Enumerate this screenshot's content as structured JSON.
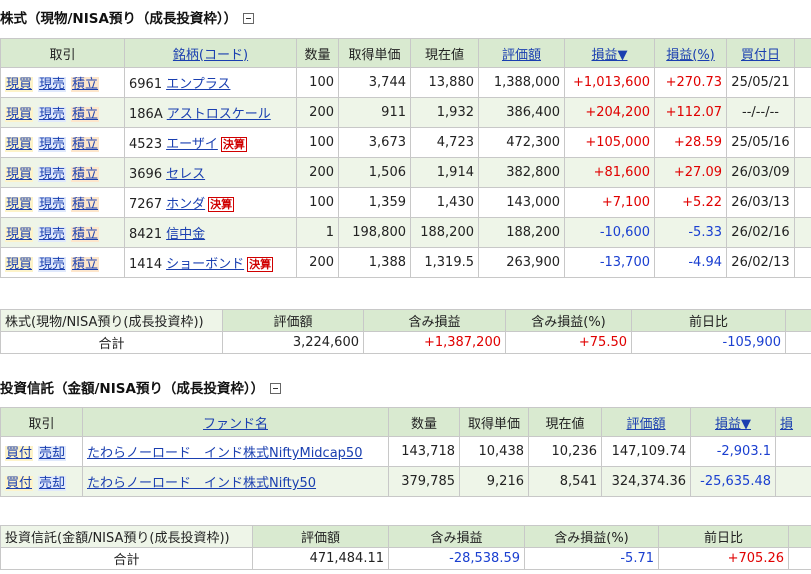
{
  "stocks": {
    "title": "株式（現物/NISA預り（成長投資枠））",
    "headers": {
      "trade": "取引",
      "name": "銘柄(コード)",
      "qty": "数量",
      "cost": "取得単価",
      "price": "現在値",
      "value": "評価額",
      "pl": "損益▼",
      "plpct": "損益(%)",
      "date": "買付日"
    },
    "actions": {
      "buy": "現買",
      "sell": "現売",
      "accumulate": "積立"
    },
    "badge": "決算",
    "rows": [
      {
        "code": "6961",
        "name": "エンプラス",
        "badge": false,
        "qty": "100",
        "cost": "3,744",
        "price": "13,880",
        "value": "1,388,000",
        "pl": "+1,013,600",
        "plpct": "+270.73",
        "date": "25/05/21",
        "sign": "pos"
      },
      {
        "code": "186A",
        "name": "アストロスケール",
        "badge": false,
        "qty": "200",
        "cost": "911",
        "price": "1,932",
        "value": "386,400",
        "pl": "+204,200",
        "plpct": "+112.07",
        "date": "--/--/--",
        "sign": "pos"
      },
      {
        "code": "4523",
        "name": "エーザイ",
        "badge": true,
        "qty": "100",
        "cost": "3,673",
        "price": "4,723",
        "value": "472,300",
        "pl": "+105,000",
        "plpct": "+28.59",
        "date": "25/05/16",
        "sign": "pos"
      },
      {
        "code": "3696",
        "name": "セレス",
        "badge": false,
        "qty": "200",
        "cost": "1,506",
        "price": "1,914",
        "value": "382,800",
        "pl": "+81,600",
        "plpct": "+27.09",
        "date": "26/03/09",
        "sign": "pos"
      },
      {
        "code": "7267",
        "name": "ホンダ",
        "badge": true,
        "qty": "100",
        "cost": "1,359",
        "price": "1,430",
        "value": "143,000",
        "pl": "+7,100",
        "plpct": "+5.22",
        "date": "26/03/13",
        "sign": "pos"
      },
      {
        "code": "8421",
        "name": "信中金",
        "badge": false,
        "qty": "1",
        "cost": "198,800",
        "price": "188,200",
        "value": "188,200",
        "pl": "-10,600",
        "plpct": "-5.33",
        "date": "26/02/16",
        "sign": "neg"
      },
      {
        "code": "1414",
        "name": "ショーボンド",
        "badge": true,
        "qty": "200",
        "cost": "1,388",
        "price": "1,319.5",
        "value": "263,900",
        "pl": "-13,700",
        "plpct": "-4.94",
        "date": "26/02/13",
        "sign": "neg"
      }
    ],
    "summary": {
      "label": "株式(現物/NISA預り(成長投資枠))",
      "total_label": "合計",
      "h_value": "評価額",
      "h_pl": "含み損益",
      "h_plpct": "含み損益(%)",
      "h_prev": "前日比",
      "value": "3,224,600",
      "pl": "+1,387,200",
      "plpct": "+75.50",
      "prev": "-105,900"
    }
  },
  "funds": {
    "title": "投資信託（金額/NISA預り（成長投資枠））",
    "headers": {
      "trade": "取引",
      "name": "ファンド名",
      "qty": "数量",
      "cost": "取得単価",
      "price": "現在値",
      "value": "評価額",
      "pl": "損益▼",
      "extra": "損"
    },
    "actions": {
      "buy": "買付",
      "sell": "売却"
    },
    "rows": [
      {
        "name": "たわらノーロード　インド株式NiftyMidcap50",
        "qty": "143,718",
        "cost": "10,438",
        "price": "10,236",
        "value": "147,109.74",
        "pl": "-2,903.1"
      },
      {
        "name": "たわらノーロード　インド株式Nifty50",
        "qty": "379,785",
        "cost": "9,216",
        "price": "8,541",
        "value": "324,374.36",
        "pl": "-25,635.48"
      }
    ],
    "summary": {
      "label": "投資信託(金額/NISA預り(成長投資枠))",
      "total_label": "合計",
      "h_value": "評価額",
      "h_pl": "含み損益",
      "h_plpct": "含み損益(%)",
      "h_prev": "前日比",
      "value": "471,484.11",
      "pl": "-28,538.59",
      "plpct": "-5.71",
      "prev": "+705.26"
    }
  },
  "colors": {
    "header_bg": "#d9ead0",
    "row_alt": "#eef5e8",
    "positive": "#e00000",
    "negative": "#1a3fd0",
    "link": "#1a3fb0"
  }
}
